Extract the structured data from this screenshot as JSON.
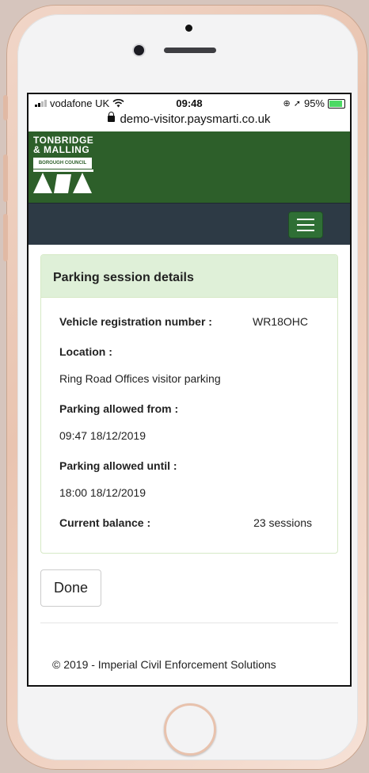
{
  "status": {
    "carrier": "vodafone UK",
    "time": "09:48",
    "battery": "95%"
  },
  "browser": {
    "url": "demo-visitor.paysmarti.co.uk"
  },
  "logo": {
    "line1": "TONBRIDGE",
    "line2": "& MALLING",
    "line3": "BOROUGH COUNCIL"
  },
  "panel": {
    "title": "Parking session details",
    "vrn_label": "Vehicle registration number :",
    "vrn_value": "WR18OHC",
    "location_label": "Location :",
    "location_value": "Ring Road Offices visitor parking",
    "from_label": "Parking allowed from :",
    "from_value": "09:47 18/12/2019",
    "until_label": "Parking allowed until :",
    "until_value": "18:00 18/12/2019",
    "balance_label": "Current balance :",
    "balance_value": "23 sessions"
  },
  "done_label": "Done",
  "footer": "© 2019 - Imperial Civil Enforcement Solutions",
  "colors": {
    "header_green": "#2d5f2a",
    "navbar": "#2d3a45",
    "panel_heading": "#dff0d8"
  },
  "icons": [
    "wifi-icon",
    "lock-icon",
    "location-arrow-icon",
    "battery-icon",
    "hamburger-menu-icon"
  ]
}
